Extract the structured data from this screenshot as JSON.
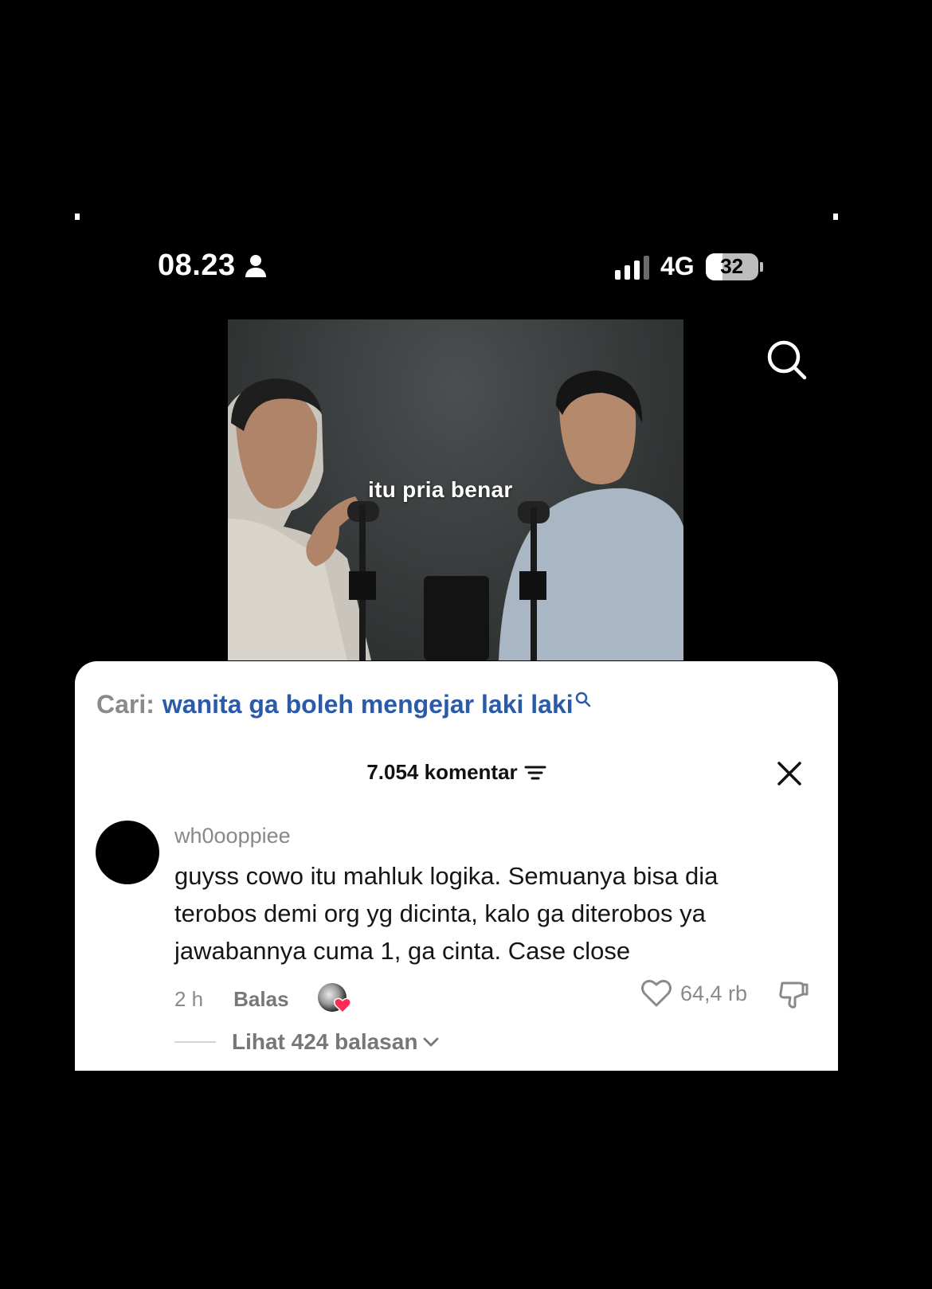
{
  "status_bar": {
    "time": "08.23",
    "network": "4G",
    "battery": "32",
    "battery_level": 0.32
  },
  "video": {
    "caption": "itu pria benar"
  },
  "search_suggestion": {
    "prefix": "Cari:",
    "query": "wanita ga boleh mengejar laki laki"
  },
  "comments_panel": {
    "count_label": "7.054 komentar"
  },
  "comment": {
    "username": "wh0ooppiee",
    "text": "guyss cowo itu mahluk logika. Semuanya bisa dia terobos demi org yg dicinta, kalo ga diterobos ya jawabannya cuma 1, ga cinta. Case close",
    "time": "2 h",
    "reply_label": "Balas",
    "likes": "64,4 rb",
    "view_replies": "Lihat 424 balasan"
  },
  "colors": {
    "background": "#000000",
    "sheet": "#ffffff",
    "search_query": "#2b5aa8",
    "creator_heart": "#fe2c55"
  }
}
